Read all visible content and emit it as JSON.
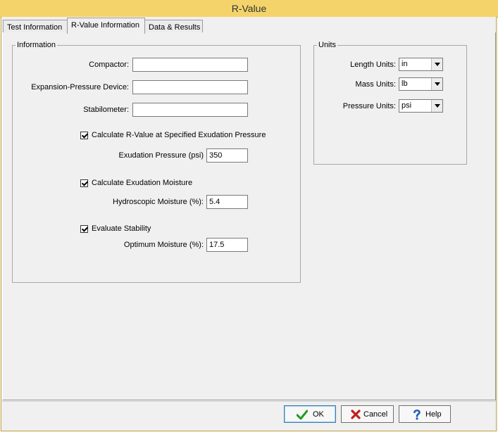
{
  "window": {
    "title": "R-Value"
  },
  "tabs": [
    {
      "label": "Test Information"
    },
    {
      "label": "R-Value Information"
    },
    {
      "label": "Data & Results"
    }
  ],
  "information": {
    "legend": "Information",
    "compactor_label": "Compactor:",
    "compactor_value": "",
    "expansion_label": "Expansion-Pressure Device:",
    "expansion_value": "",
    "stabilometer_label": "Stabilometer:",
    "stabilometer_value": "",
    "calc_rvalue_label": "Calculate R-Value at Specified Exudation Pressure",
    "exudation_pressure_label": "Exudation Pressure (psi)",
    "exudation_pressure_value": "350",
    "calc_exudation_moisture_label": "Calculate Exudation Moisture",
    "hydroscopic_label": "Hydroscopic Moisture (%):",
    "hydroscopic_value": "5.4",
    "evaluate_stability_label": "Evaluate Stability",
    "optimum_label": "Optimum Moisture (%):",
    "optimum_value": "17.5"
  },
  "units": {
    "legend": "Units",
    "length_label": "Length Units:",
    "length_value": "in",
    "mass_label": "Mass Units:",
    "mass_value": "lb",
    "pressure_label": "Pressure Units:",
    "pressure_value": "psi"
  },
  "buttons": {
    "ok": "OK",
    "cancel": "Cancel",
    "help": "Help"
  },
  "icons": {
    "ok": "checkmark-icon",
    "cancel": "x-icon",
    "help": "question-icon"
  }
}
